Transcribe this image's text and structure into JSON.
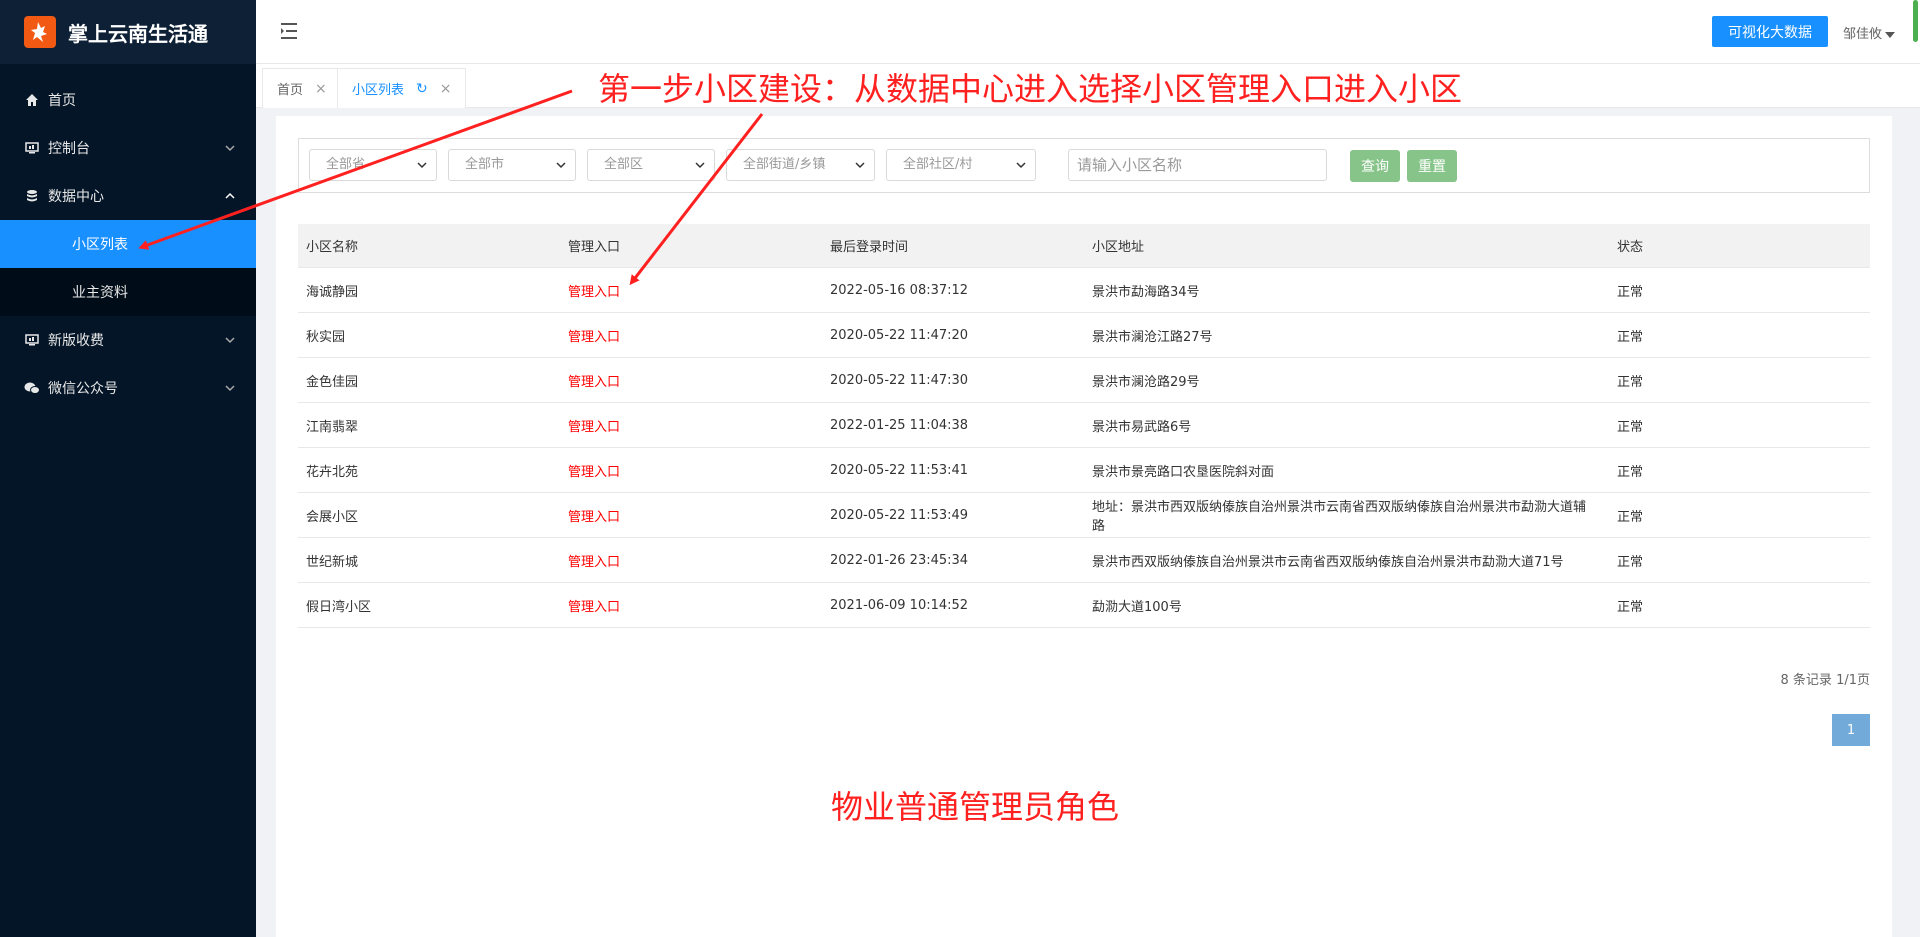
{
  "brand": {
    "name": "掌上云南生活通",
    "logo_icon": "fire-runner-icon",
    "accent": "#f25a13"
  },
  "sidebar": {
    "items": [
      {
        "label": "首页",
        "icon": "home-icon"
      },
      {
        "label": "控制台",
        "icon": "monitor-icon"
      },
      {
        "label": "数据中心",
        "icon": "database-icon"
      },
      {
        "label": "新版收费",
        "icon": "monitor-icon"
      },
      {
        "label": "微信公众号",
        "icon": "wechat-icon"
      }
    ],
    "sub_items": [
      {
        "label": "小区列表",
        "active": true
      },
      {
        "label": "业主资料",
        "active": false
      }
    ],
    "active_color": "#1890ff"
  },
  "header": {
    "big_data_label": "可视化大数据",
    "user_name": "邹佳攸"
  },
  "tabs": [
    {
      "label": "首页"
    },
    {
      "label": "小区列表"
    }
  ],
  "filters": {
    "province": "全部省",
    "city": "全部市",
    "district": "全部区",
    "street": "全部街道/乡镇",
    "community": "全部社区/村",
    "name_placeholder": "请输入小区名称",
    "search_label": "查询",
    "reset_label": "重置"
  },
  "table": {
    "headers": [
      "小区名称",
      "管理入口",
      "最后登录时间",
      "小区地址",
      "状态"
    ],
    "rows": [
      {
        "name": "海诚静园",
        "entry": "管理入口",
        "time": "2022-05-16 08:37:12",
        "address": "景洪市勐海路34号",
        "status": "正常"
      },
      {
        "name": "秋实园",
        "entry": "管理入口",
        "time": "2020-05-22 11:47:20",
        "address": "景洪市澜沧江路27号",
        "status": "正常"
      },
      {
        "name": "金色佳园",
        "entry": "管理入口",
        "time": "2020-05-22 11:47:30",
        "address": "景洪市澜沧路29号",
        "status": "正常"
      },
      {
        "name": "江南翡翠",
        "entry": "管理入口",
        "time": "2022-01-25 11:04:38",
        "address": "景洪市易武路6号",
        "status": "正常"
      },
      {
        "name": "花卉北苑",
        "entry": "管理入口",
        "time": "2020-05-22 11:53:41",
        "address": "景洪市景亮路口农垦医院斜对面",
        "status": "正常"
      },
      {
        "name": "会展小区",
        "entry": "管理入口",
        "time": "2020-05-22 11:53:49",
        "address": "地址：景洪市西双版纳傣族自治州景洪市云南省西双版纳傣族自治州景洪市勐泐大道辅路",
        "status": "正常"
      },
      {
        "name": "世纪新城",
        "entry": "管理入口",
        "time": "2022-01-26 23:45:34",
        "address": "景洪市西双版纳傣族自治州景洪市云南省西双版纳傣族自治州景洪市勐泐大道71号",
        "status": "正常"
      },
      {
        "name": "假日湾小区",
        "entry": "管理入口",
        "time": "2021-06-09 10:14:52",
        "address": "勐泐大道100号",
        "status": "正常"
      }
    ]
  },
  "pagination": {
    "info": "8 条记录 1/1页",
    "current": "1"
  },
  "annotations": {
    "step_text": "第一步小区建设：从数据中心进入选择小区管理入口进入小区",
    "role_text": "物业普通管理员角色",
    "color": "#ff2020"
  }
}
